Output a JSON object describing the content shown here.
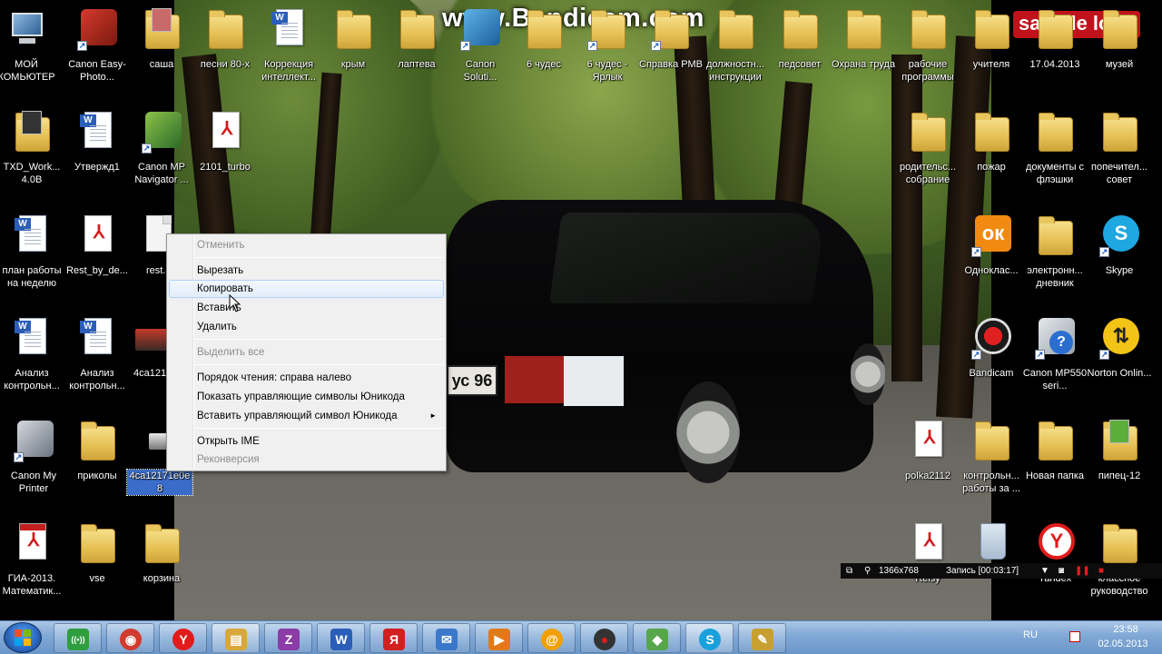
{
  "watermark": {
    "bandicam": "www.Bandicam.com",
    "sample_logo": "sample logo"
  },
  "plate_text": "ус 96",
  "desktop_icons": [
    {
      "label": "МОЙ КОМЬЮТЕР",
      "icon": "computer-icon"
    },
    {
      "label": "Canon Easy-Photo...",
      "icon": "printer-app-icon"
    },
    {
      "label": "саша",
      "icon": "folder-icon"
    },
    {
      "label": "песни 80-х",
      "icon": "folder-icon"
    },
    {
      "label": "Коррекция интеллект...",
      "icon": "word-document-icon"
    },
    {
      "label": "крым",
      "icon": "folder-icon"
    },
    {
      "label": "лаптева",
      "icon": "folder-icon"
    },
    {
      "label": "Canon Soluti...",
      "icon": "app-shortcut-icon"
    },
    {
      "label": "6 чудес",
      "icon": "folder-icon"
    },
    {
      "label": "6 чудес - Ярлык",
      "icon": "folder-shortcut-icon"
    },
    {
      "label": "Справка РМВ",
      "icon": "folder-shortcut-icon"
    },
    {
      "label": "должностн... инструкции",
      "icon": "folder-icon"
    },
    {
      "label": "педсовет",
      "icon": "folder-icon"
    },
    {
      "label": "Охрана труда",
      "icon": "folder-icon"
    },
    {
      "label": "рабочие программы",
      "icon": "folder-icon"
    },
    {
      "label": "учителя",
      "icon": "folder-icon"
    },
    {
      "label": "17.04.2013",
      "icon": "folder-icon"
    },
    {
      "label": "музей",
      "icon": "folder-icon"
    },
    {
      "label": "TXD_Work... 4.0B",
      "icon": "folder-icon"
    },
    {
      "label": "Утвержд1",
      "icon": "word-document-icon"
    },
    {
      "label": "Canon MP Navigator ...",
      "icon": "scanner-app-icon"
    },
    {
      "label": "2101_turbo",
      "icon": "pdf-icon"
    },
    {
      "label": "родительс... собрание",
      "icon": "folder-icon"
    },
    {
      "label": "пожар",
      "icon": "folder-icon"
    },
    {
      "label": "документы с флэшки",
      "icon": "folder-icon"
    },
    {
      "label": "попечител... совет",
      "icon": "folder-icon"
    },
    {
      "label": "план работы на неделю",
      "icon": "word-document-icon"
    },
    {
      "label": "Rest_by_de...",
      "icon": "pdf-icon"
    },
    {
      "label": "rest.c",
      "icon": "blank-file-icon"
    },
    {
      "label": "Одноклас...",
      "icon": "odnoklassniki-icon"
    },
    {
      "label": "электронн... дневник",
      "icon": "folder-icon"
    },
    {
      "label": "Skype",
      "icon": "skype-icon"
    },
    {
      "label": "Анализ контрольн...",
      "icon": "word-document-icon"
    },
    {
      "label": "Анализ контрольн...",
      "icon": "word-document-icon"
    },
    {
      "label": "4ca1217",
      "icon": "image-file-icon"
    },
    {
      "label": "Bandicam",
      "icon": "bandicam-icon"
    },
    {
      "label": "Canon MP550 seri...",
      "icon": "help-app-icon"
    },
    {
      "label": "Norton Onlin...",
      "icon": "norton-icon"
    },
    {
      "label": "Canon My Printer",
      "icon": "printer-app-icon"
    },
    {
      "label": "приколы",
      "icon": "folder-icon"
    },
    {
      "label": "4ca12171e0e8",
      "icon": "image-file-icon"
    },
    {
      "label": "polka2112",
      "icon": "pdf-icon"
    },
    {
      "label": "контрольн... работы за ...",
      "icon": "folder-icon"
    },
    {
      "label": "Новая папка",
      "icon": "folder-icon"
    },
    {
      "label": "пипец-12",
      "icon": "folder-icon"
    },
    {
      "label": "ГИА-2013. Математик...",
      "icon": "adobe-pdf-icon"
    },
    {
      "label": "vse",
      "icon": "folder-icon"
    },
    {
      "label": "корзина",
      "icon": "folder-icon"
    },
    {
      "label": "Reisy",
      "icon": "pdf-icon"
    },
    {
      "label": "Yandex",
      "icon": "yandex-icon"
    },
    {
      "label": "классное руководство",
      "icon": "folder-icon"
    }
  ],
  "rename_field": {
    "value": "4ca12171e0e8"
  },
  "context_menu": {
    "items": [
      {
        "label": "Отменить",
        "disabled": true
      },
      {
        "label": "Вырезать",
        "disabled": false
      },
      {
        "label": "Копировать",
        "disabled": false,
        "hovered": true
      },
      {
        "label": "Вставить",
        "disabled": false
      },
      {
        "label": "Удалить",
        "disabled": false
      },
      {
        "label": "Выделить все",
        "disabled": true
      },
      {
        "label": "Порядок чтения: справа налево",
        "disabled": false
      },
      {
        "label": "Показать управляющие символы Юникода",
        "disabled": false
      },
      {
        "label": "Вставить управляющий символ Юникода",
        "disabled": false,
        "submenu": true
      },
      {
        "label": "Открыть IME",
        "disabled": false
      },
      {
        "label": "Реконверсия",
        "disabled": true
      }
    ],
    "submenu_arrow": "►"
  },
  "bandicam_bar": {
    "resolution": "1366x768",
    "record_label": "Запись [00:03:17]"
  },
  "taskbar": {
    "items": [
      {
        "name": "start-button"
      },
      {
        "name": "network-app",
        "glyph": "((•))",
        "color": "#2e9e3e"
      },
      {
        "name": "chrome",
        "glyph": "◉",
        "color": "#d23a2e"
      },
      {
        "name": "yandex-browser",
        "glyph": "Y",
        "color": "#e11b1b"
      },
      {
        "name": "explorer",
        "glyph": "▤",
        "color": "#d9a83a"
      },
      {
        "name": "zuma",
        "glyph": "Z",
        "color": "#8b3ca6"
      },
      {
        "name": "word",
        "glyph": "W",
        "color": "#2b5eb8"
      },
      {
        "name": "yandex-app",
        "glyph": "Я",
        "color": "#d02020"
      },
      {
        "name": "mail-agent",
        "glyph": "✉",
        "color": "#3b78c8"
      },
      {
        "name": "media-player",
        "glyph": "▶",
        "color": "#e07a18"
      },
      {
        "name": "mail-ru",
        "glyph": "@",
        "color": "#f0a000"
      },
      {
        "name": "bandicam-taskbar",
        "glyph": "●",
        "color": "#c0121b"
      },
      {
        "name": "game-app",
        "glyph": "◆",
        "color": "#57a64b"
      },
      {
        "name": "skype-taskbar",
        "glyph": "S",
        "color": "#1aa0dc"
      },
      {
        "name": "paint",
        "glyph": "✎",
        "color": "#c8a030"
      }
    ],
    "tray": {
      "language": "RU",
      "time": "23:58",
      "date": "02.05.2013"
    }
  }
}
